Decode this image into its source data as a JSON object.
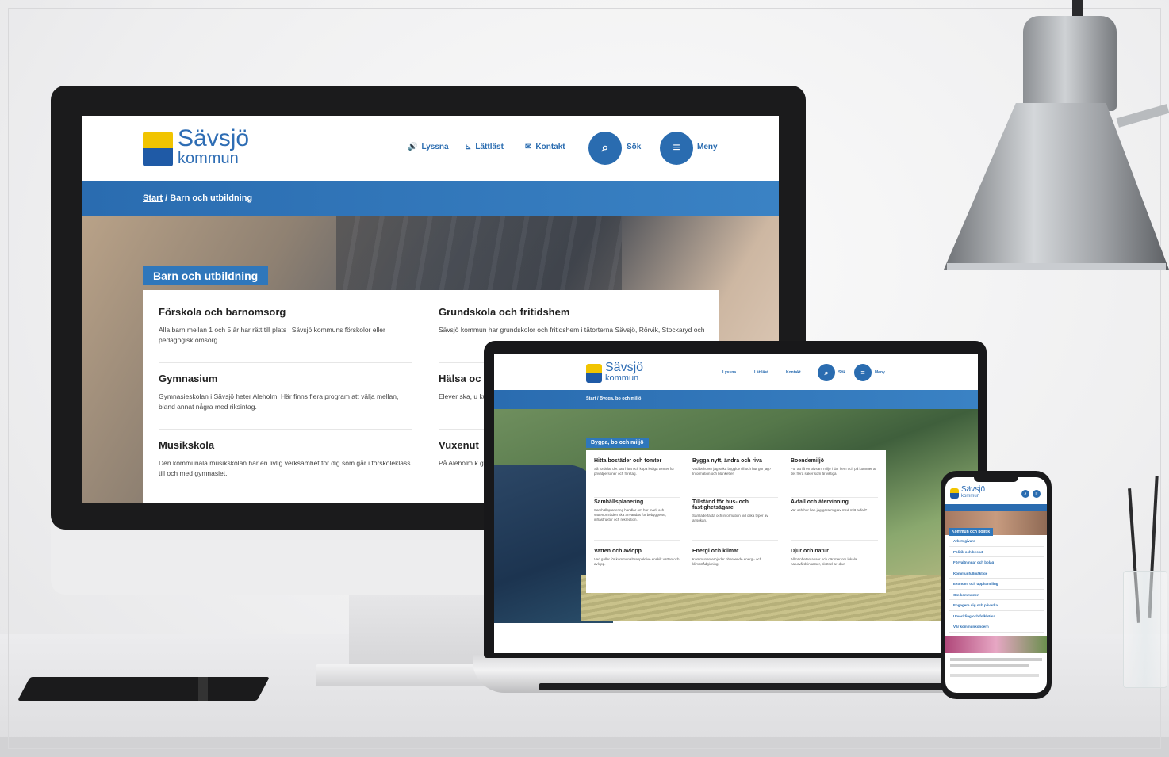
{
  "desktop": {
    "logo_top": "Sävsjö",
    "logo_bottom": "kommun",
    "nav": {
      "listen": "Lyssna",
      "easy_read": "Lättläst",
      "contact": "Kontakt",
      "search": "Sök",
      "menu": "Meny"
    },
    "breadcrumb": {
      "home": "Start",
      "separator": "/",
      "current": "Barn och utbildning"
    },
    "section_title": "Barn och utbildning",
    "cards": [
      {
        "title": "Förskola och barnomsorg",
        "text": "Alla barn mellan 1 och 5 år har rätt till plats i Sävsjö kommuns förskolor eller pedagogisk omsorg."
      },
      {
        "title": "Grundskola och fritidshem",
        "text": "Sävsjö kommun har grundskolor och fritidshem i tätorterna Sävsjö, Rörvik, Stockaryd och"
      },
      {
        "title": "Gymnasium",
        "text": "Gymnasieskolan i Sävsjö heter Aleholm. Här finns flera program att välja mellan, bland annat några med riksintag."
      },
      {
        "title": "Hälsa oc",
        "text": "Elever ska, u kurator och p"
      },
      {
        "title": "Musikskola",
        "text": "Den kommunala musikskolan har en livlig verksamhet för dig som går i förskoleklass till och med gymnasiet."
      },
      {
        "title": "Vuxenut",
        "text": "På Aleholm k gymnasienivå"
      }
    ]
  },
  "laptop": {
    "logo_top": "Sävsjö",
    "logo_bottom": "kommun",
    "nav": {
      "listen": "Lyssna",
      "easy_read": "Lättläst",
      "contact": "Kontakt",
      "search": "Sök",
      "menu": "Meny"
    },
    "breadcrumb": "Start / Bygga, bo och miljö",
    "section_title": "Bygga, bo och miljö",
    "cards": [
      {
        "title": "Hitta bostäder och tomter",
        "text": "Så fördelar det sätt hitta och köpa lediga tomter för privatpersoner och företag."
      },
      {
        "title": "Bygga nytt, ändra och riva",
        "text": "Vad behöver jag söka bygglov till och hur gör jag? Information och blanketter."
      },
      {
        "title": "Boendemiljö",
        "text": "För att få en trivsam miljö i där hem och på kommer är det flera saker som är viktiga."
      },
      {
        "title": "Samhällsplanering",
        "text": "Samhällsplanering handlar om hur mark och vattenområden ska användas för bebyggelse, infrastruktur och rekreation."
      },
      {
        "title": "Tillstånd för hus- och fastighetsägare",
        "text": "Samlade fakta och information vid olika typer av ansökan."
      },
      {
        "title": "Avfall och återvinning",
        "text": "Var och hur kan jag göra mig av med mitt avfall?"
      },
      {
        "title": "Vatten och avlopp",
        "text": "Vad gäller för kommunalt respektive enskilt vatten och avlopp."
      },
      {
        "title": "Energi och klimat",
        "text": "Kommunen erbjuder oberoende energi- och klimatrådgivning."
      },
      {
        "title": "Djur och natur",
        "text": "Allmänheten anser och där mer om lokala naturvårdsinsatser, skötsel av djur."
      }
    ]
  },
  "phone": {
    "logo_top": "Sävsjö",
    "logo_bottom": "kommun",
    "section_title": "Kommun och politik",
    "items": [
      "Arbetsgivare",
      "Politik och beslut",
      "Förvaltningar och bolag",
      "Kommunfullmäktige",
      "Ekonomi och upphandling",
      "Om kommunen",
      "Engagera dig och påverka",
      "Utveckling och folkhälsa",
      "Vår kommunkoncern"
    ]
  },
  "colors": {
    "brand_blue": "#2a6cb0",
    "brand_yellow": "#f1c400"
  }
}
